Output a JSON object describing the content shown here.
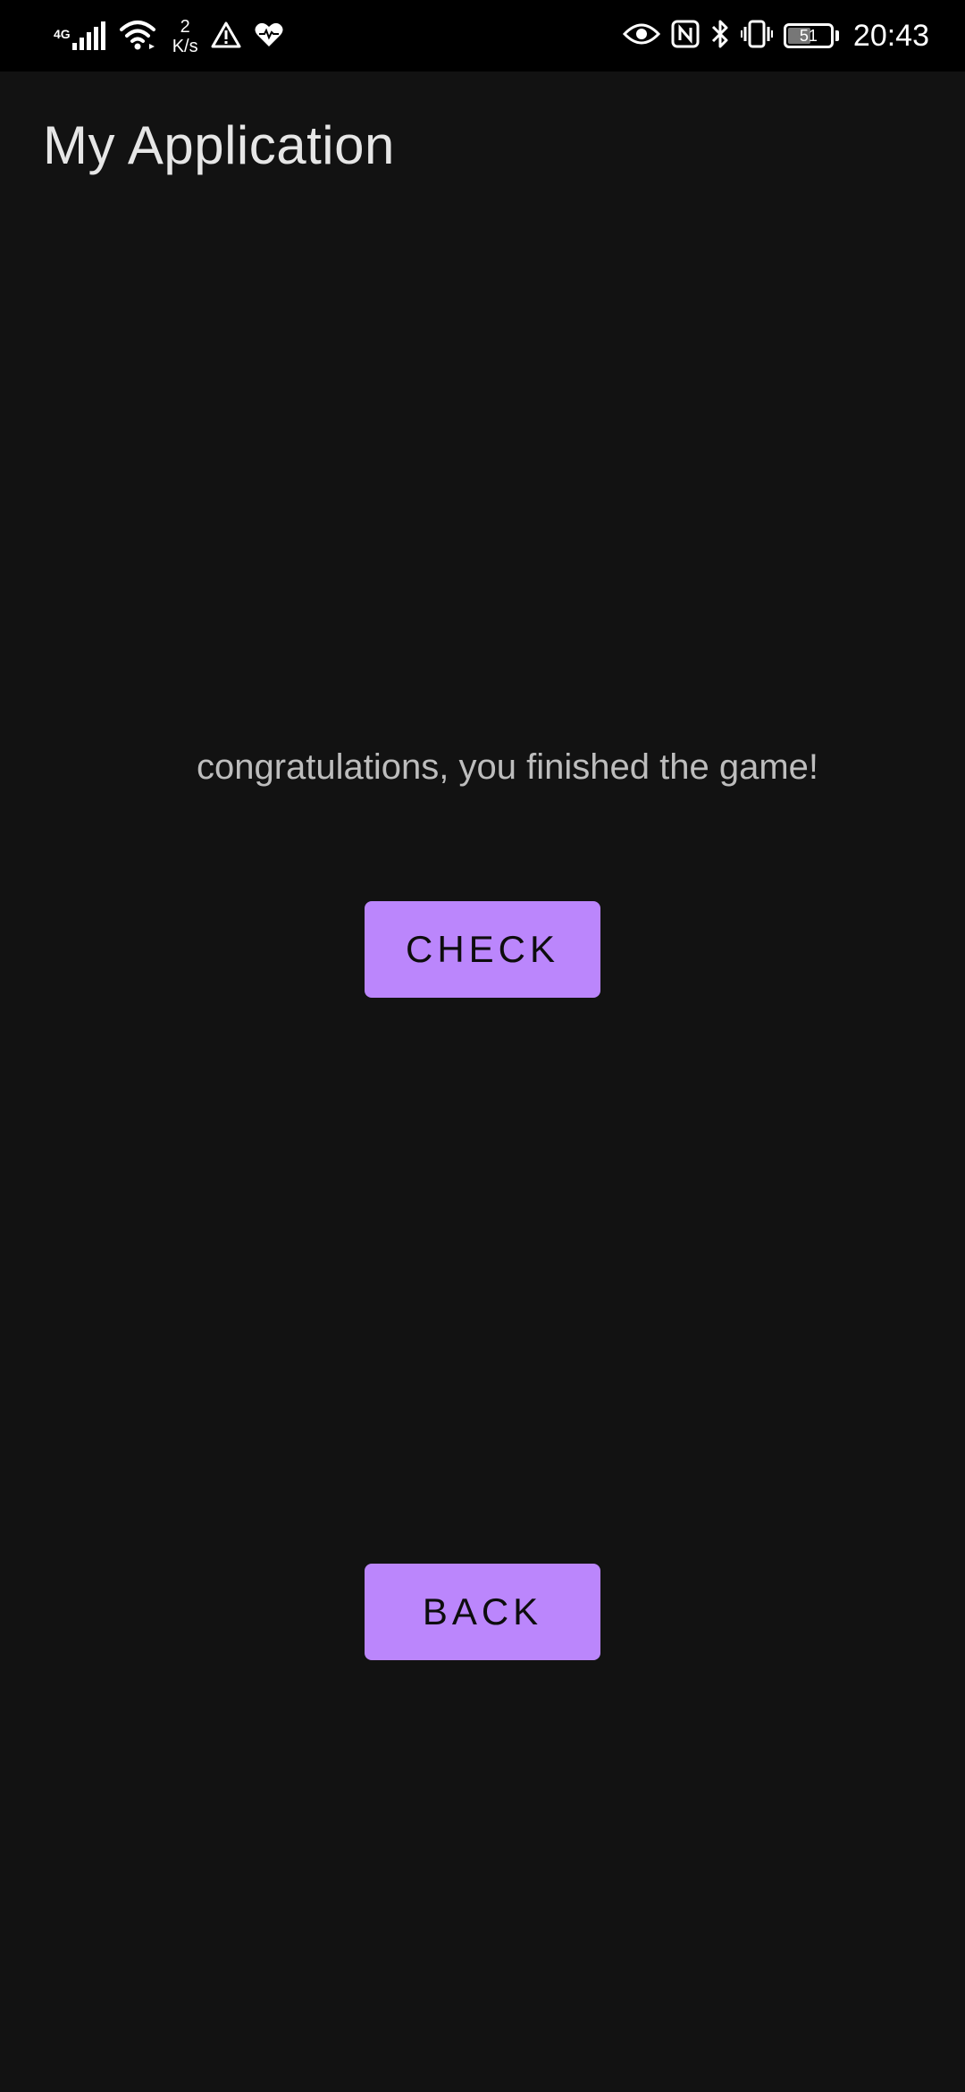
{
  "status_bar": {
    "network_type": "4G",
    "speed_value": "2",
    "speed_unit": "K/s",
    "battery_level": "51",
    "time": "20:43",
    "icons": [
      "signal-icon",
      "wifi-icon",
      "warning-icon",
      "heart-icon",
      "eye-icon",
      "nfc-icon",
      "bluetooth-icon",
      "vibrate-icon",
      "battery-icon"
    ]
  },
  "app_bar": {
    "title": "My Application"
  },
  "main": {
    "message": "congratulations, you finished the game!",
    "check_label": "CHECK",
    "back_label": "BACK"
  },
  "colors": {
    "background": "#121212",
    "status_bar": "#000000",
    "button": "#bb86fc",
    "button_text": "#0d0d0d",
    "title_text": "#e6e6e6",
    "message_text": "#bdbdbd"
  }
}
